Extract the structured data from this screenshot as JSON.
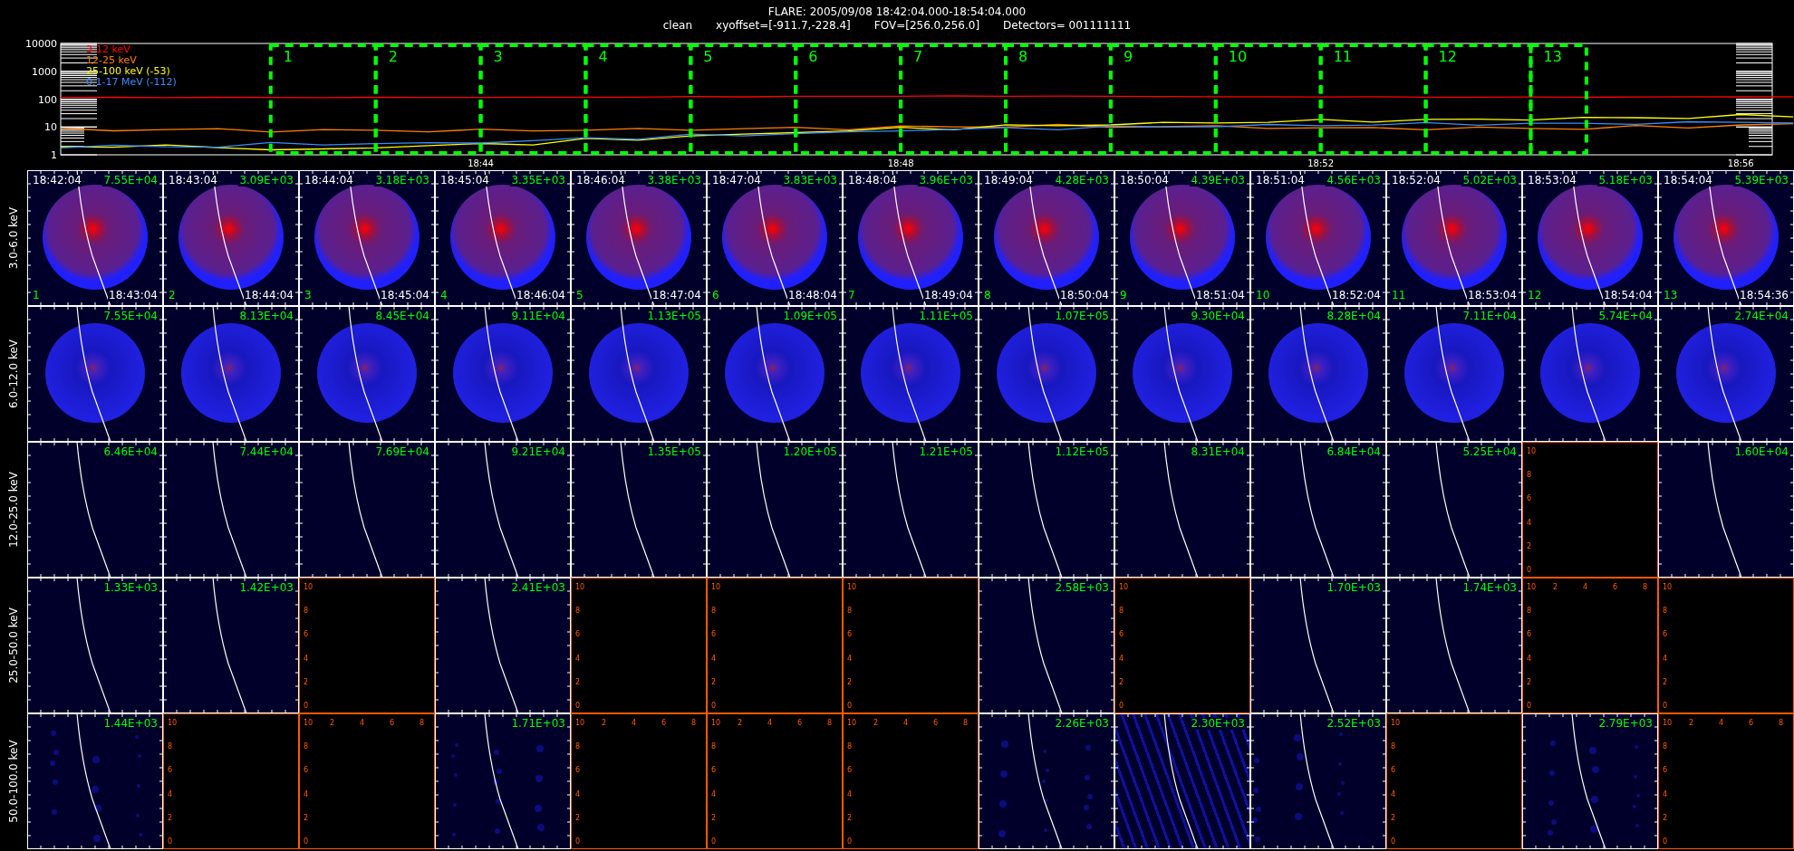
{
  "header": {
    "title": "FLARE: 2005/09/08 18:42:04.000-18:54:04.000",
    "info": [
      "clean",
      "xyoffset=[-911.7,-228.4]",
      "FOV=[256.0,256.0]",
      "Detectors= 001111111"
    ]
  },
  "lightcurve": {
    "y_labels": [
      "10000",
      "1000",
      "100",
      "10",
      "1"
    ],
    "time_labels": [
      "18:44",
      "18:48",
      "18:52",
      "18:56"
    ],
    "legend": [
      {
        "label": "3-12 keV",
        "color": "#ff0000"
      },
      {
        "label": "12-25 keV",
        "color": "#ff8000"
      },
      {
        "label": "25-100 keV (-53)",
        "color": "#ffff00"
      },
      {
        "label": "0.1-17 MeV (-112)",
        "color": "#3c8cff"
      }
    ],
    "intervals": [
      "1",
      "2",
      "3",
      "4",
      "5",
      "6",
      "7",
      "8",
      "9",
      "10",
      "11",
      "12",
      "13"
    ]
  },
  "rows": [
    {
      "label": "3.0-6.0 keV",
      "panels": [
        {
          "kind": "disk",
          "value": "7.55E+04",
          "start": "18:42:04",
          "end": "18:43:04",
          "index": "1"
        },
        {
          "kind": "disk",
          "value": "3.09E+03",
          "start": "18:43:04",
          "end": "18:44:04",
          "index": "2"
        },
        {
          "kind": "disk",
          "value": "3.18E+03",
          "start": "18:44:04",
          "end": "18:45:04",
          "index": "3"
        },
        {
          "kind": "disk",
          "value": "3.35E+03",
          "start": "18:45:04",
          "end": "18:46:04",
          "index": "4"
        },
        {
          "kind": "disk",
          "value": "3.38E+03",
          "start": "18:46:04",
          "end": "18:47:04",
          "index": "5"
        },
        {
          "kind": "disk",
          "value": "3.83E+03",
          "start": "18:47:04",
          "end": "18:48:04",
          "index": "6"
        },
        {
          "kind": "disk",
          "value": "3.96E+03",
          "start": "18:48:04",
          "end": "18:49:04",
          "index": "7"
        },
        {
          "kind": "disk",
          "value": "4.28E+03",
          "start": "18:49:04",
          "end": "18:50:04",
          "index": "8"
        },
        {
          "kind": "disk",
          "value": "4.39E+03",
          "start": "18:50:04",
          "end": "18:51:04",
          "index": "9"
        },
        {
          "kind": "disk",
          "value": "4.56E+03",
          "start": "18:51:04",
          "end": "18:52:04",
          "index": "10"
        },
        {
          "kind": "disk",
          "value": "5.02E+03",
          "start": "18:52:04",
          "end": "18:53:04",
          "index": "11"
        },
        {
          "kind": "disk",
          "value": "5.18E+03",
          "start": "18:53:04",
          "end": "18:54:04",
          "index": "12"
        },
        {
          "kind": "disk",
          "value": "5.39E+03",
          "start": "18:54:04",
          "end": "18:54:36",
          "index": "13"
        }
      ]
    },
    {
      "label": "6.0-12.0 keV",
      "panels": [
        {
          "kind": "blue_disk",
          "value": "7.55E+04"
        },
        {
          "kind": "blue_disk",
          "value": "8.13E+04"
        },
        {
          "kind": "blue_disk",
          "value": "8.45E+04"
        },
        {
          "kind": "blue_disk",
          "value": "9.11E+04"
        },
        {
          "kind": "blue_disk",
          "value": "1.13E+05"
        },
        {
          "kind": "blue_disk",
          "value": "1.09E+05"
        },
        {
          "kind": "blue_disk",
          "value": "1.11E+05"
        },
        {
          "kind": "blue_disk",
          "value": "1.07E+05"
        },
        {
          "kind": "blue_disk",
          "value": "9.30E+04"
        },
        {
          "kind": "blue_disk",
          "value": "8.28E+04"
        },
        {
          "kind": "blue_disk",
          "value": "7.11E+04"
        },
        {
          "kind": "blue_disk",
          "value": "5.74E+04"
        },
        {
          "kind": "blue_disk",
          "value": "2.74E+04"
        }
      ]
    },
    {
      "label": "12.0-25.0 keV",
      "panels": [
        {
          "kind": "faint",
          "value": "6.46E+04"
        },
        {
          "kind": "faint",
          "value": "7.44E+04"
        },
        {
          "kind": "faint",
          "value": "7.69E+04"
        },
        {
          "kind": "faint",
          "value": "9.21E+04"
        },
        {
          "kind": "faint",
          "value": "1.35E+05"
        },
        {
          "kind": "faint",
          "value": "1.20E+05"
        },
        {
          "kind": "faint",
          "value": "1.21E+05"
        },
        {
          "kind": "faint",
          "value": "1.12E+05"
        },
        {
          "kind": "faint",
          "value": "8.31E+04"
        },
        {
          "kind": "faint",
          "value": "6.84E+04"
        },
        {
          "kind": "faint",
          "value": "5.25E+04"
        },
        {
          "kind": "empty",
          "y_ticks": [
            "10",
            "8",
            "6",
            "4",
            "2",
            "0"
          ]
        },
        {
          "kind": "faint",
          "value": "1.60E+04"
        }
      ]
    },
    {
      "label": "25.0-50.0 keV",
      "panels": [
        {
          "kind": "faint",
          "value": "1.33E+03"
        },
        {
          "kind": "faint",
          "value": "1.42E+03"
        },
        {
          "kind": "empty",
          "y_ticks": [
            "10",
            "8",
            "6",
            "4",
            "2",
            "0"
          ]
        },
        {
          "kind": "faint",
          "value": "2.41E+03"
        },
        {
          "kind": "empty",
          "y_ticks": [
            "10",
            "8",
            "6",
            "4",
            "2",
            "0"
          ]
        },
        {
          "kind": "empty",
          "y_ticks": [
            "10",
            "8",
            "6",
            "4",
            "2",
            "0"
          ]
        },
        {
          "kind": "empty",
          "y_ticks": [
            "10",
            "8",
            "6",
            "4",
            "2",
            "0"
          ]
        },
        {
          "kind": "faint",
          "value": "2.58E+03"
        },
        {
          "kind": "empty",
          "y_ticks": [
            "10",
            "8",
            "6",
            "4",
            "2",
            "0"
          ]
        },
        {
          "kind": "faint",
          "value": "1.70E+03"
        },
        {
          "kind": "faint",
          "value": "1.74E+03"
        },
        {
          "kind": "empty",
          "y_ticks": [
            "10",
            "8",
            "6",
            "4",
            "2",
            "0"
          ],
          "x_ticks": [
            "2",
            "4",
            "6",
            "8"
          ]
        },
        {
          "kind": "empty",
          "y_ticks": [
            "10",
            "8",
            "6",
            "4",
            "2",
            "0"
          ]
        }
      ]
    },
    {
      "label": "50.0-100.0 keV",
      "panels": [
        {
          "kind": "noise",
          "value": "1.44E+03"
        },
        {
          "kind": "empty",
          "y_ticks": [
            "10",
            "8",
            "6",
            "4",
            "2",
            "0"
          ]
        },
        {
          "kind": "empty",
          "y_ticks": [
            "10",
            "8",
            "6",
            "4",
            "2",
            "0"
          ],
          "x_ticks": [
            "2",
            "4",
            "6",
            "8"
          ]
        },
        {
          "kind": "noise",
          "value": "1.71E+03"
        },
        {
          "kind": "empty",
          "y_ticks": [
            "10",
            "8",
            "6",
            "4",
            "2",
            "0"
          ],
          "x_ticks": [
            "2",
            "4",
            "6",
            "8"
          ]
        },
        {
          "kind": "empty",
          "y_ticks": [
            "10",
            "8",
            "6",
            "4",
            "2",
            "0"
          ],
          "x_ticks": [
            "2",
            "4",
            "6",
            "8"
          ]
        },
        {
          "kind": "empty",
          "y_ticks": [
            "10",
            "8",
            "6",
            "4",
            "2",
            "0"
          ],
          "x_ticks": [
            "2",
            "4",
            "6",
            "8"
          ]
        },
        {
          "kind": "noise",
          "value": "2.26E+03"
        },
        {
          "kind": "stripes",
          "value": "2.30E+03"
        },
        {
          "kind": "noise",
          "value": "2.52E+03"
        },
        {
          "kind": "empty",
          "y_ticks": [
            "10",
            "8",
            "6",
            "4",
            "2",
            "0"
          ]
        },
        {
          "kind": "noise",
          "value": "2.79E+03"
        },
        {
          "kind": "empty",
          "y_ticks": [
            "10",
            "8",
            "6",
            "4",
            "2",
            "0"
          ],
          "x_ticks": [
            "2",
            "4",
            "6",
            "8"
          ]
        }
      ]
    }
  ]
}
